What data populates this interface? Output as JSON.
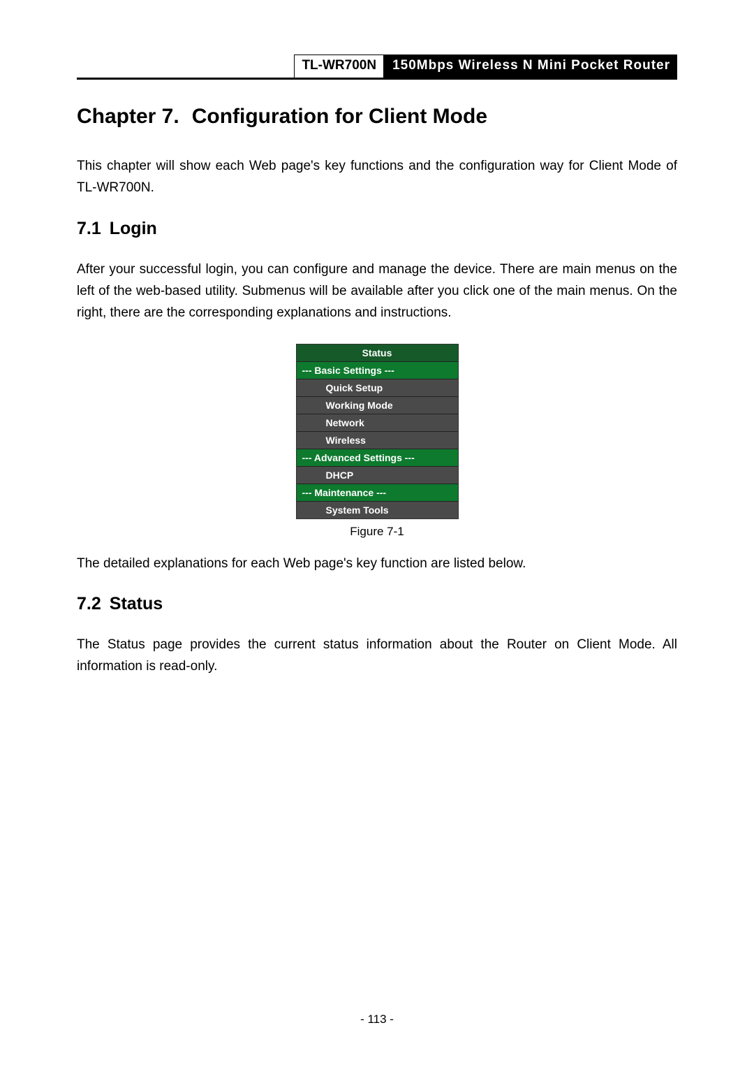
{
  "header": {
    "model": "TL-WR700N",
    "product": "150Mbps Wireless N Mini Pocket Router"
  },
  "chapter": {
    "number": "Chapter 7.",
    "title": "Configuration for Client Mode"
  },
  "intro_para": "This chapter will show each Web page's key functions and the configuration way for Client Mode of TL-WR700N.",
  "sections": {
    "login": {
      "number": "7.1",
      "title": "Login",
      "para": "After your successful login, you can configure and manage the device. There are main menus on the left of the web-based utility. Submenus will be available after you click one of the main menus. On the right, there are the corresponding explanations and instructions."
    },
    "status": {
      "number": "7.2",
      "title": "Status",
      "para": "The Status page provides the current status information about the Router on Client Mode. All information is read-only."
    }
  },
  "menu": {
    "items": [
      {
        "label": "Status",
        "type": "selected"
      },
      {
        "label": "--- Basic Settings ---",
        "type": "section"
      },
      {
        "label": "Quick Setup",
        "type": "regular"
      },
      {
        "label": "Working Mode",
        "type": "regular"
      },
      {
        "label": "Network",
        "type": "regular"
      },
      {
        "label": "Wireless",
        "type": "regular"
      },
      {
        "label": "--- Advanced Settings ---",
        "type": "section"
      },
      {
        "label": "DHCP",
        "type": "regular"
      },
      {
        "label": "--- Maintenance ---",
        "type": "section"
      },
      {
        "label": "System Tools",
        "type": "regular"
      }
    ]
  },
  "figure_caption": "Figure 7-1",
  "after_figure_para": "The detailed explanations for each Web page's key function are listed below.",
  "page_number": "- 113 -"
}
